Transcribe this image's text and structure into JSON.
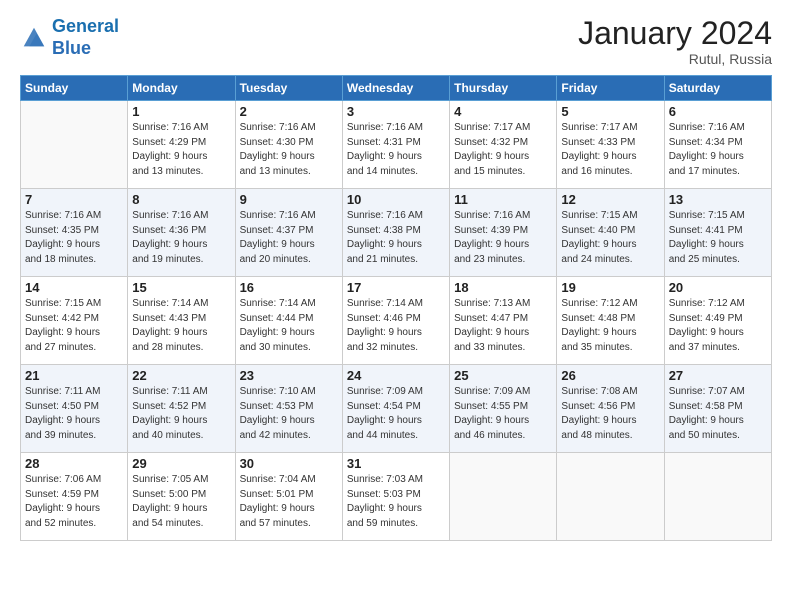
{
  "header": {
    "logo_line1": "General",
    "logo_line2": "Blue",
    "month_year": "January 2024",
    "location": "Rutul, Russia"
  },
  "days_of_week": [
    "Sunday",
    "Monday",
    "Tuesday",
    "Wednesday",
    "Thursday",
    "Friday",
    "Saturday"
  ],
  "weeks": [
    [
      {
        "num": "",
        "info": ""
      },
      {
        "num": "1",
        "info": "Sunrise: 7:16 AM\nSunset: 4:29 PM\nDaylight: 9 hours\nand 13 minutes."
      },
      {
        "num": "2",
        "info": "Sunrise: 7:16 AM\nSunset: 4:30 PM\nDaylight: 9 hours\nand 13 minutes."
      },
      {
        "num": "3",
        "info": "Sunrise: 7:16 AM\nSunset: 4:31 PM\nDaylight: 9 hours\nand 14 minutes."
      },
      {
        "num": "4",
        "info": "Sunrise: 7:17 AM\nSunset: 4:32 PM\nDaylight: 9 hours\nand 15 minutes."
      },
      {
        "num": "5",
        "info": "Sunrise: 7:17 AM\nSunset: 4:33 PM\nDaylight: 9 hours\nand 16 minutes."
      },
      {
        "num": "6",
        "info": "Sunrise: 7:16 AM\nSunset: 4:34 PM\nDaylight: 9 hours\nand 17 minutes."
      }
    ],
    [
      {
        "num": "7",
        "info": "Sunrise: 7:16 AM\nSunset: 4:35 PM\nDaylight: 9 hours\nand 18 minutes."
      },
      {
        "num": "8",
        "info": "Sunrise: 7:16 AM\nSunset: 4:36 PM\nDaylight: 9 hours\nand 19 minutes."
      },
      {
        "num": "9",
        "info": "Sunrise: 7:16 AM\nSunset: 4:37 PM\nDaylight: 9 hours\nand 20 minutes."
      },
      {
        "num": "10",
        "info": "Sunrise: 7:16 AM\nSunset: 4:38 PM\nDaylight: 9 hours\nand 21 minutes."
      },
      {
        "num": "11",
        "info": "Sunrise: 7:16 AM\nSunset: 4:39 PM\nDaylight: 9 hours\nand 23 minutes."
      },
      {
        "num": "12",
        "info": "Sunrise: 7:15 AM\nSunset: 4:40 PM\nDaylight: 9 hours\nand 24 minutes."
      },
      {
        "num": "13",
        "info": "Sunrise: 7:15 AM\nSunset: 4:41 PM\nDaylight: 9 hours\nand 25 minutes."
      }
    ],
    [
      {
        "num": "14",
        "info": "Sunrise: 7:15 AM\nSunset: 4:42 PM\nDaylight: 9 hours\nand 27 minutes."
      },
      {
        "num": "15",
        "info": "Sunrise: 7:14 AM\nSunset: 4:43 PM\nDaylight: 9 hours\nand 28 minutes."
      },
      {
        "num": "16",
        "info": "Sunrise: 7:14 AM\nSunset: 4:44 PM\nDaylight: 9 hours\nand 30 minutes."
      },
      {
        "num": "17",
        "info": "Sunrise: 7:14 AM\nSunset: 4:46 PM\nDaylight: 9 hours\nand 32 minutes."
      },
      {
        "num": "18",
        "info": "Sunrise: 7:13 AM\nSunset: 4:47 PM\nDaylight: 9 hours\nand 33 minutes."
      },
      {
        "num": "19",
        "info": "Sunrise: 7:12 AM\nSunset: 4:48 PM\nDaylight: 9 hours\nand 35 minutes."
      },
      {
        "num": "20",
        "info": "Sunrise: 7:12 AM\nSunset: 4:49 PM\nDaylight: 9 hours\nand 37 minutes."
      }
    ],
    [
      {
        "num": "21",
        "info": "Sunrise: 7:11 AM\nSunset: 4:50 PM\nDaylight: 9 hours\nand 39 minutes."
      },
      {
        "num": "22",
        "info": "Sunrise: 7:11 AM\nSunset: 4:52 PM\nDaylight: 9 hours\nand 40 minutes."
      },
      {
        "num": "23",
        "info": "Sunrise: 7:10 AM\nSunset: 4:53 PM\nDaylight: 9 hours\nand 42 minutes."
      },
      {
        "num": "24",
        "info": "Sunrise: 7:09 AM\nSunset: 4:54 PM\nDaylight: 9 hours\nand 44 minutes."
      },
      {
        "num": "25",
        "info": "Sunrise: 7:09 AM\nSunset: 4:55 PM\nDaylight: 9 hours\nand 46 minutes."
      },
      {
        "num": "26",
        "info": "Sunrise: 7:08 AM\nSunset: 4:56 PM\nDaylight: 9 hours\nand 48 minutes."
      },
      {
        "num": "27",
        "info": "Sunrise: 7:07 AM\nSunset: 4:58 PM\nDaylight: 9 hours\nand 50 minutes."
      }
    ],
    [
      {
        "num": "28",
        "info": "Sunrise: 7:06 AM\nSunset: 4:59 PM\nDaylight: 9 hours\nand 52 minutes."
      },
      {
        "num": "29",
        "info": "Sunrise: 7:05 AM\nSunset: 5:00 PM\nDaylight: 9 hours\nand 54 minutes."
      },
      {
        "num": "30",
        "info": "Sunrise: 7:04 AM\nSunset: 5:01 PM\nDaylight: 9 hours\nand 57 minutes."
      },
      {
        "num": "31",
        "info": "Sunrise: 7:03 AM\nSunset: 5:03 PM\nDaylight: 9 hours\nand 59 minutes."
      },
      {
        "num": "",
        "info": ""
      },
      {
        "num": "",
        "info": ""
      },
      {
        "num": "",
        "info": ""
      }
    ]
  ]
}
